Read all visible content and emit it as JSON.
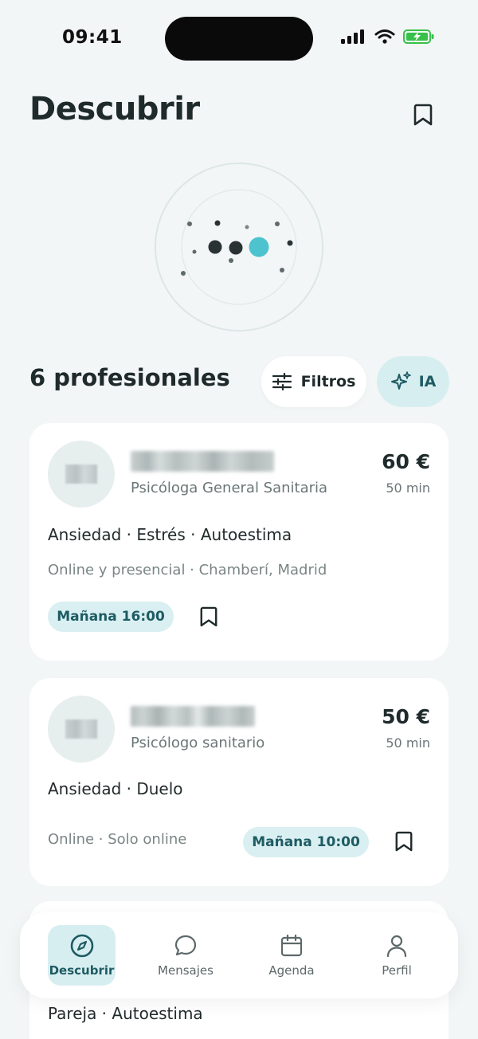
{
  "status_bar": {
    "time": "09:41"
  },
  "header": {
    "title": "Descubrir",
    "bookmark_icon": "bookmark-icon"
  },
  "results": {
    "count_label": "6 profesionales"
  },
  "filters": {
    "label": "Filtros",
    "icon": "sliders-icon"
  },
  "ai": {
    "label": "IA",
    "icon": "sparkles-icon"
  },
  "cards": [
    {
      "role": "Psicóloga General Sanitaria",
      "price": "60 €",
      "duration": "50 min",
      "tags": "Ansiedad · Estrés · Autoestima",
      "location": "Online y presencial · Chamberí, Madrid",
      "slot": "Mañana 16:00"
    },
    {
      "role": "Psicólogo sanitario",
      "price": "50 €",
      "duration": "50 min",
      "tags": "Ansiedad · Duelo",
      "location": "Online · Solo online",
      "slot": "Mañana 10:00"
    },
    {
      "tags": "Pareja · Autoestima"
    }
  ],
  "nav": [
    {
      "label": "Descubrir",
      "icon": "compass-icon",
      "active": true
    },
    {
      "label": "Mensajes",
      "icon": "chat-bubble-icon",
      "active": false
    },
    {
      "label": "Agenda",
      "icon": "calendar-icon",
      "active": false
    },
    {
      "label": "Perfil",
      "icon": "user-icon",
      "active": false
    }
  ],
  "colors": {
    "background": "#f3f6f6",
    "accent": "#4cc3cf",
    "accent_soft": "#d7eef0",
    "accent_text": "#1e5b63",
    "text": "#1f2a2b"
  }
}
